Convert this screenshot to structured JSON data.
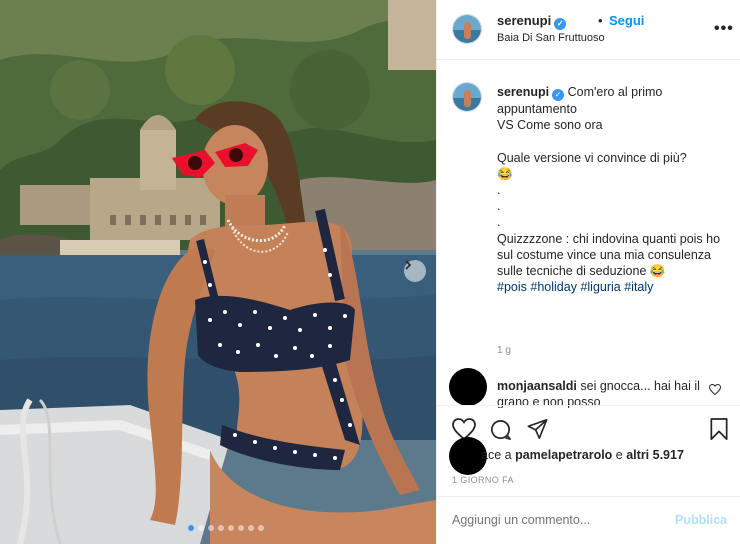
{
  "post": {
    "username": "serenupi",
    "follow_separator": "•",
    "follow_label": "Segui",
    "location": "Baia Di San Fruttuoso",
    "more_icon": "ellipsis-icon",
    "carousel_dots": 8,
    "carousel_active": 0
  },
  "caption": {
    "username": "serenupi",
    "lines": [
      "Com'ero al primo appuntamento",
      "VS Come sono ora",
      "",
      "Quale versione vi convince di più?",
      "😂",
      ".",
      ".",
      ".",
      "Quizzzzone : chi indovina quanti pois ho sul costume vince una mia consulenza sulle tecniche di seduzione 😂"
    ],
    "hashtags": [
      "#pois",
      "#holiday",
      "#liguria",
      "#italy"
    ],
    "time": "1 g"
  },
  "comment": {
    "username": "monjaansaldi",
    "text": "sei gnocca... hai hai il grano e non posso"
  },
  "likes": {
    "prefix": "ace a ",
    "user": "pamelapetrarolo",
    "connector": " e ",
    "others": "altri 5.917"
  },
  "date": "1 GIORNO FA",
  "add_comment": {
    "placeholder": "Aggiungi un commento...",
    "publish_label": "Pubblica"
  },
  "colors": {
    "accent": "#0095f6",
    "link": "#00376b",
    "muted": "#8e8e8e",
    "publish_disabled": "#b2dffc",
    "sunglasses": "#e8102a"
  }
}
